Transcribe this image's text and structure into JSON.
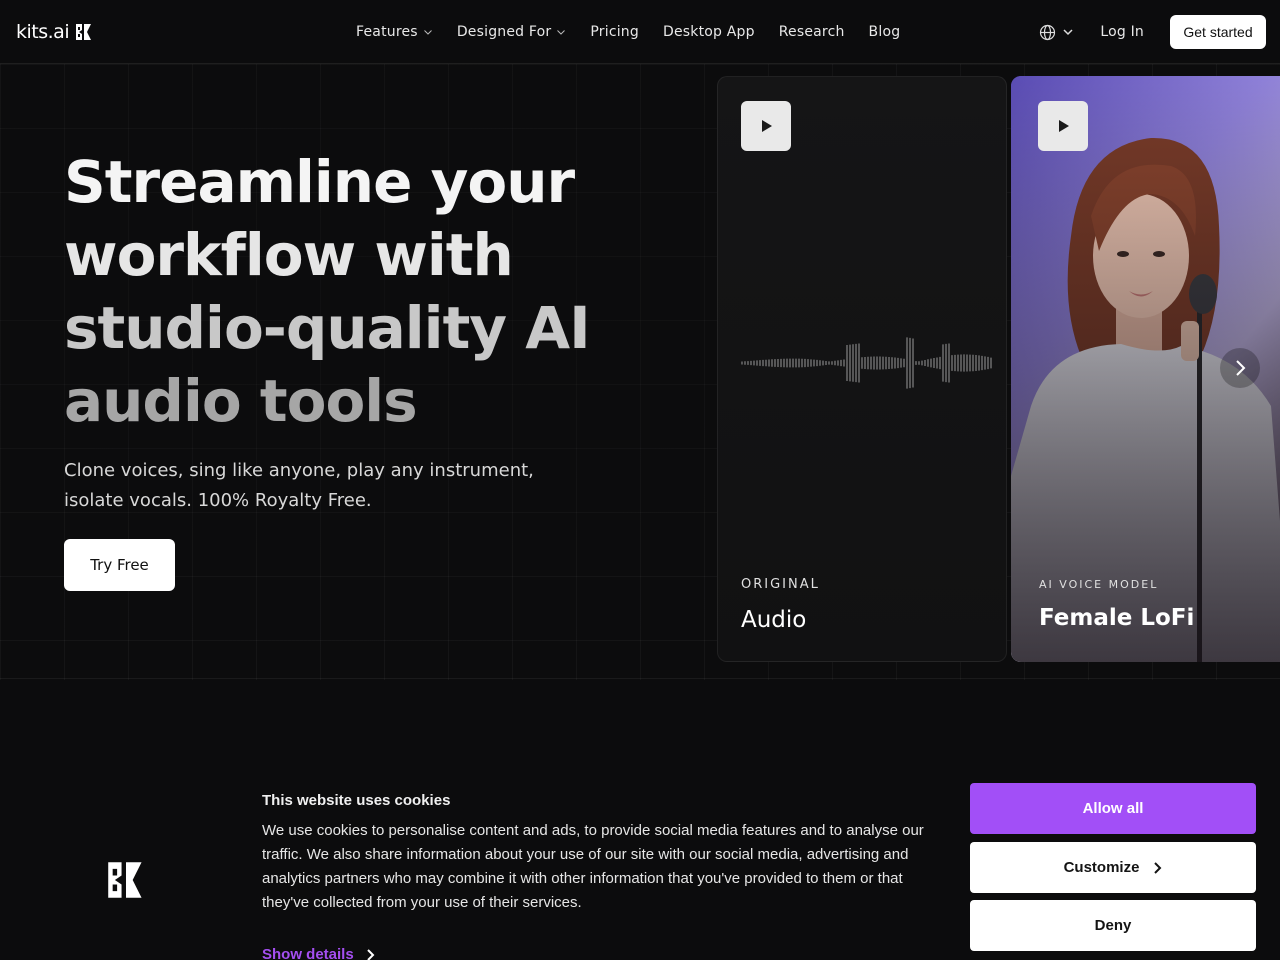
{
  "header": {
    "logo_text": "kits.ai",
    "nav": [
      {
        "label": "Features",
        "has_dropdown": true
      },
      {
        "label": "Designed For",
        "has_dropdown": true
      },
      {
        "label": "Pricing",
        "has_dropdown": false
      },
      {
        "label": "Desktop App",
        "has_dropdown": false
      },
      {
        "label": "Research",
        "has_dropdown": false
      },
      {
        "label": "Blog",
        "has_dropdown": false
      }
    ],
    "language_icon": "globe-icon",
    "login_label": "Log In",
    "cta_label": "Get started"
  },
  "hero": {
    "title_lines": [
      "Streamline your",
      "workflow with",
      "studio-quality AI",
      "audio tools"
    ],
    "subtitle_lines": [
      "Clone voices, sing like anyone, play any instrument,",
      "isolate vocals. 100% Royalty Free."
    ],
    "cta_label": "Try Free"
  },
  "cards": [
    {
      "kicker": "ORIGINAL",
      "title": "Audio",
      "play_icon": "play-icon"
    },
    {
      "kicker": "AI VOICE MODEL",
      "title": "Female LoFi",
      "play_icon": "play-icon"
    }
  ],
  "carousel": {
    "next_icon": "chevron-right-icon"
  },
  "cookie_banner": {
    "title": "This website uses cookies",
    "body": "We use cookies to personalise content and ads, to provide social media features and to analyse our traffic. We also share information about your use of our site with our social media, advertising and analytics partners who may combine it with other information that you've provided to them or that they've collected from your use of their services.",
    "show_details_label": "Show details",
    "allow_label": "Allow all",
    "customize_label": "Customize",
    "deny_label": "Deny",
    "accent_color": "#a24ff7"
  }
}
